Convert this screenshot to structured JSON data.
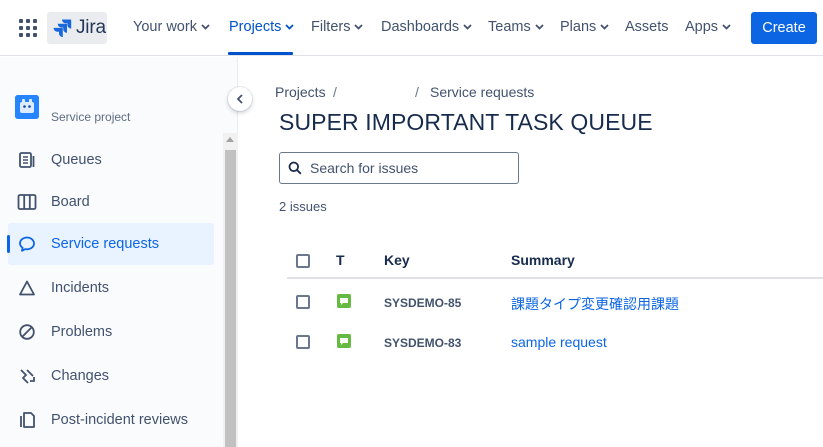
{
  "topnav": {
    "logo_text": "Jira",
    "items": [
      {
        "label": "Your work"
      },
      {
        "label": "Projects"
      },
      {
        "label": "Filters"
      },
      {
        "label": "Dashboards"
      },
      {
        "label": "Teams"
      },
      {
        "label": "Plans"
      },
      {
        "label": "Assets"
      },
      {
        "label": "Apps"
      }
    ],
    "active_item": "Projects",
    "create_label": "Create",
    "accent_color": "#0c66e4"
  },
  "sidebar": {
    "project_type": "Service project",
    "items": [
      {
        "label": "Queues",
        "icon": "queues-icon"
      },
      {
        "label": "Board",
        "icon": "board-icon"
      },
      {
        "label": "Service requests",
        "icon": "speech-bubble-icon",
        "selected": true
      },
      {
        "label": "Incidents",
        "icon": "warning-triangle-icon"
      },
      {
        "label": "Problems",
        "icon": "no-entry-icon"
      },
      {
        "label": "Changes",
        "icon": "changes-arrows-icon"
      },
      {
        "label": "Post-incident reviews",
        "icon": "document-icon"
      }
    ]
  },
  "breadcrumb": {
    "root": "Projects",
    "current": "Service requests"
  },
  "main": {
    "title": "SUPER IMPORTANT TASK QUEUE",
    "search_placeholder": "Search for issues",
    "issue_count": "2 issues",
    "columns": {
      "type": "T",
      "key": "Key",
      "summary": "Summary"
    },
    "issues": [
      {
        "key": "SYSDEMO-85",
        "summary": "課題タイプ変更確認用課題",
        "type_icon": "service-request-icon"
      },
      {
        "key": "SYSDEMO-83",
        "summary": "sample request",
        "type_icon": "service-request-icon"
      }
    ]
  }
}
